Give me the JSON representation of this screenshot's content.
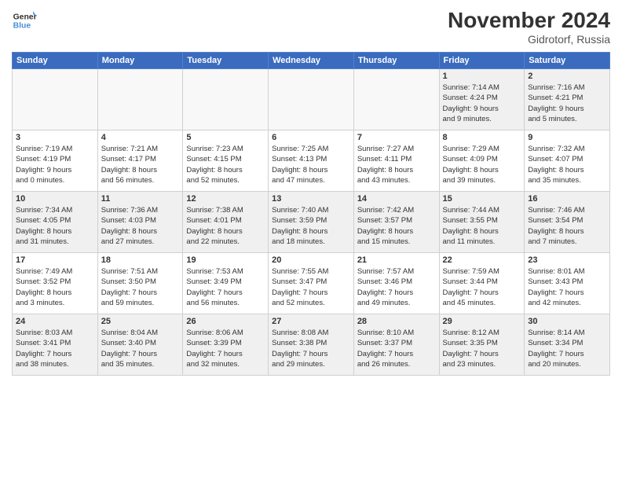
{
  "logo": {
    "text_general": "General",
    "text_blue": "Blue"
  },
  "header": {
    "title": "November 2024",
    "location": "Gidrotorf, Russia"
  },
  "weekdays": [
    "Sunday",
    "Monday",
    "Tuesday",
    "Wednesday",
    "Thursday",
    "Friday",
    "Saturday"
  ],
  "weeks": [
    [
      {
        "day": "",
        "info": ""
      },
      {
        "day": "",
        "info": ""
      },
      {
        "day": "",
        "info": ""
      },
      {
        "day": "",
        "info": ""
      },
      {
        "day": "",
        "info": ""
      },
      {
        "day": "1",
        "info": "Sunrise: 7:14 AM\nSunset: 4:24 PM\nDaylight: 9 hours\nand 9 minutes."
      },
      {
        "day": "2",
        "info": "Sunrise: 7:16 AM\nSunset: 4:21 PM\nDaylight: 9 hours\nand 5 minutes."
      }
    ],
    [
      {
        "day": "3",
        "info": "Sunrise: 7:19 AM\nSunset: 4:19 PM\nDaylight: 9 hours\nand 0 minutes."
      },
      {
        "day": "4",
        "info": "Sunrise: 7:21 AM\nSunset: 4:17 PM\nDaylight: 8 hours\nand 56 minutes."
      },
      {
        "day": "5",
        "info": "Sunrise: 7:23 AM\nSunset: 4:15 PM\nDaylight: 8 hours\nand 52 minutes."
      },
      {
        "day": "6",
        "info": "Sunrise: 7:25 AM\nSunset: 4:13 PM\nDaylight: 8 hours\nand 47 minutes."
      },
      {
        "day": "7",
        "info": "Sunrise: 7:27 AM\nSunset: 4:11 PM\nDaylight: 8 hours\nand 43 minutes."
      },
      {
        "day": "8",
        "info": "Sunrise: 7:29 AM\nSunset: 4:09 PM\nDaylight: 8 hours\nand 39 minutes."
      },
      {
        "day": "9",
        "info": "Sunrise: 7:32 AM\nSunset: 4:07 PM\nDaylight: 8 hours\nand 35 minutes."
      }
    ],
    [
      {
        "day": "10",
        "info": "Sunrise: 7:34 AM\nSunset: 4:05 PM\nDaylight: 8 hours\nand 31 minutes."
      },
      {
        "day": "11",
        "info": "Sunrise: 7:36 AM\nSunset: 4:03 PM\nDaylight: 8 hours\nand 27 minutes."
      },
      {
        "day": "12",
        "info": "Sunrise: 7:38 AM\nSunset: 4:01 PM\nDaylight: 8 hours\nand 22 minutes."
      },
      {
        "day": "13",
        "info": "Sunrise: 7:40 AM\nSunset: 3:59 PM\nDaylight: 8 hours\nand 18 minutes."
      },
      {
        "day": "14",
        "info": "Sunrise: 7:42 AM\nSunset: 3:57 PM\nDaylight: 8 hours\nand 15 minutes."
      },
      {
        "day": "15",
        "info": "Sunrise: 7:44 AM\nSunset: 3:55 PM\nDaylight: 8 hours\nand 11 minutes."
      },
      {
        "day": "16",
        "info": "Sunrise: 7:46 AM\nSunset: 3:54 PM\nDaylight: 8 hours\nand 7 minutes."
      }
    ],
    [
      {
        "day": "17",
        "info": "Sunrise: 7:49 AM\nSunset: 3:52 PM\nDaylight: 8 hours\nand 3 minutes."
      },
      {
        "day": "18",
        "info": "Sunrise: 7:51 AM\nSunset: 3:50 PM\nDaylight: 7 hours\nand 59 minutes."
      },
      {
        "day": "19",
        "info": "Sunrise: 7:53 AM\nSunset: 3:49 PM\nDaylight: 7 hours\nand 56 minutes."
      },
      {
        "day": "20",
        "info": "Sunrise: 7:55 AM\nSunset: 3:47 PM\nDaylight: 7 hours\nand 52 minutes."
      },
      {
        "day": "21",
        "info": "Sunrise: 7:57 AM\nSunset: 3:46 PM\nDaylight: 7 hours\nand 49 minutes."
      },
      {
        "day": "22",
        "info": "Sunrise: 7:59 AM\nSunset: 3:44 PM\nDaylight: 7 hours\nand 45 minutes."
      },
      {
        "day": "23",
        "info": "Sunrise: 8:01 AM\nSunset: 3:43 PM\nDaylight: 7 hours\nand 42 minutes."
      }
    ],
    [
      {
        "day": "24",
        "info": "Sunrise: 8:03 AM\nSunset: 3:41 PM\nDaylight: 7 hours\nand 38 minutes."
      },
      {
        "day": "25",
        "info": "Sunrise: 8:04 AM\nSunset: 3:40 PM\nDaylight: 7 hours\nand 35 minutes."
      },
      {
        "day": "26",
        "info": "Sunrise: 8:06 AM\nSunset: 3:39 PM\nDaylight: 7 hours\nand 32 minutes."
      },
      {
        "day": "27",
        "info": "Sunrise: 8:08 AM\nSunset: 3:38 PM\nDaylight: 7 hours\nand 29 minutes."
      },
      {
        "day": "28",
        "info": "Sunrise: 8:10 AM\nSunset: 3:37 PM\nDaylight: 7 hours\nand 26 minutes."
      },
      {
        "day": "29",
        "info": "Sunrise: 8:12 AM\nSunset: 3:35 PM\nDaylight: 7 hours\nand 23 minutes."
      },
      {
        "day": "30",
        "info": "Sunrise: 8:14 AM\nSunset: 3:34 PM\nDaylight: 7 hours\nand 20 minutes."
      }
    ]
  ]
}
